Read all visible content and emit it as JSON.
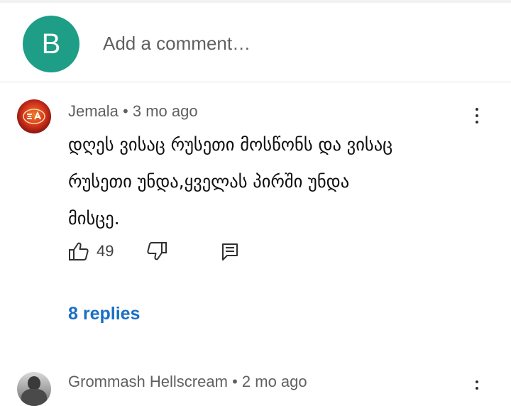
{
  "compose": {
    "avatar_letter": "B",
    "placeholder": "Add a comment…"
  },
  "comments": [
    {
      "author": "Jemala",
      "time": "3 mo ago",
      "text_lines": [
        "დღეს ვისაც რუსეთი მოსწონს და ვისაც",
        "რუსეთი უნდა,ყველას პირში უნდა",
        "მისცე."
      ],
      "likes": "49",
      "replies_label": "8 replies"
    },
    {
      "author": "Grommash Hellscream",
      "time": "2 mo ago"
    }
  ],
  "separator": "•",
  "colors": {
    "avatar_bg": "#1e9e86",
    "replies_link": "#1a6fc4",
    "meta_text": "#606060"
  },
  "icons": [
    "more-vert-icon",
    "thumb-up-icon",
    "thumb-down-icon",
    "reply-icon"
  ]
}
